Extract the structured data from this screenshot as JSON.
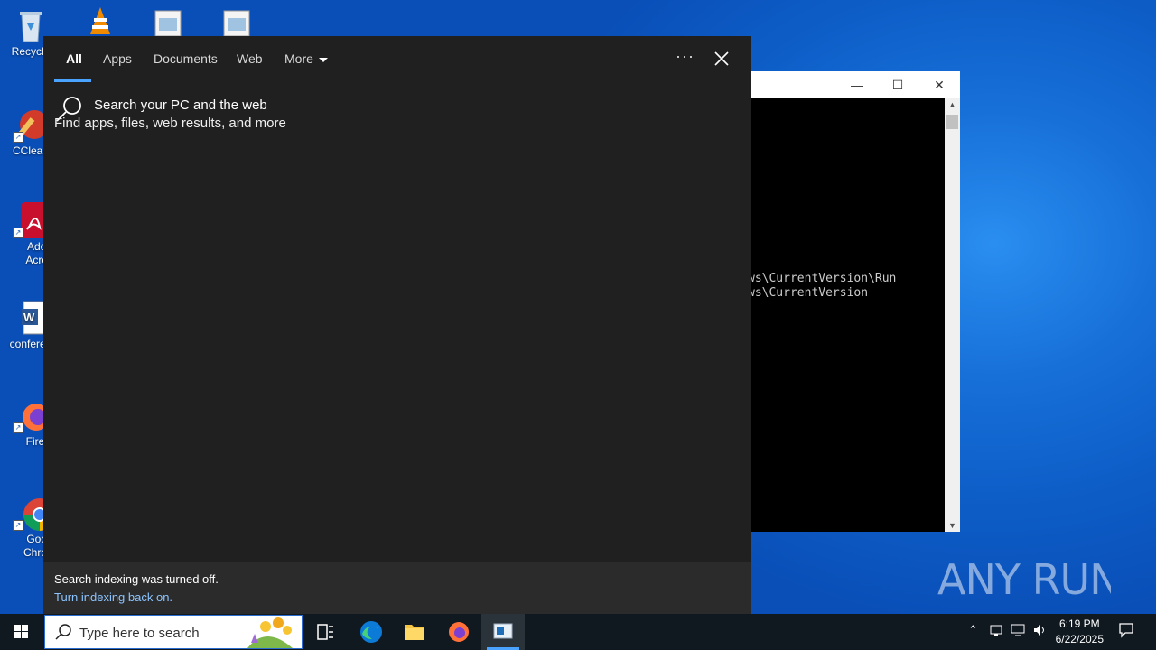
{
  "desktop": {
    "icons": [
      {
        "label": "Recycle",
        "id": "recycle-bin"
      },
      {
        "label": "CClean",
        "id": "ccleaner"
      },
      {
        "label": "Adob Acrob",
        "id": "adobe-acrobat"
      },
      {
        "label": "conferen",
        "id": "word-doc"
      },
      {
        "label": "Firefo",
        "id": "firefox"
      },
      {
        "label": "Goog Chrom",
        "id": "chrome"
      }
    ]
  },
  "console": {
    "lines": [
      "ws\\CurrentVersion\\Run",
      "ws\\CurrentVersion"
    ]
  },
  "search_panel": {
    "tabs": [
      "All",
      "Apps",
      "Documents",
      "Web",
      "More"
    ],
    "active_tab": "All",
    "hint_title": "Search your PC and the web",
    "hint_sub": "Find apps, files, web results, and more",
    "footer_msg": "Search indexing was turned off.",
    "footer_link": "Turn indexing back on."
  },
  "watermark": "ANY RUN",
  "taskbar": {
    "search_placeholder": "Type here to search",
    "time": "6:19 PM",
    "date": "6/22/2025"
  },
  "colors": {
    "panel_bg": "#202020",
    "accent": "#4aa3ff",
    "link": "#8cc4ff",
    "taskbar": "#101820"
  }
}
